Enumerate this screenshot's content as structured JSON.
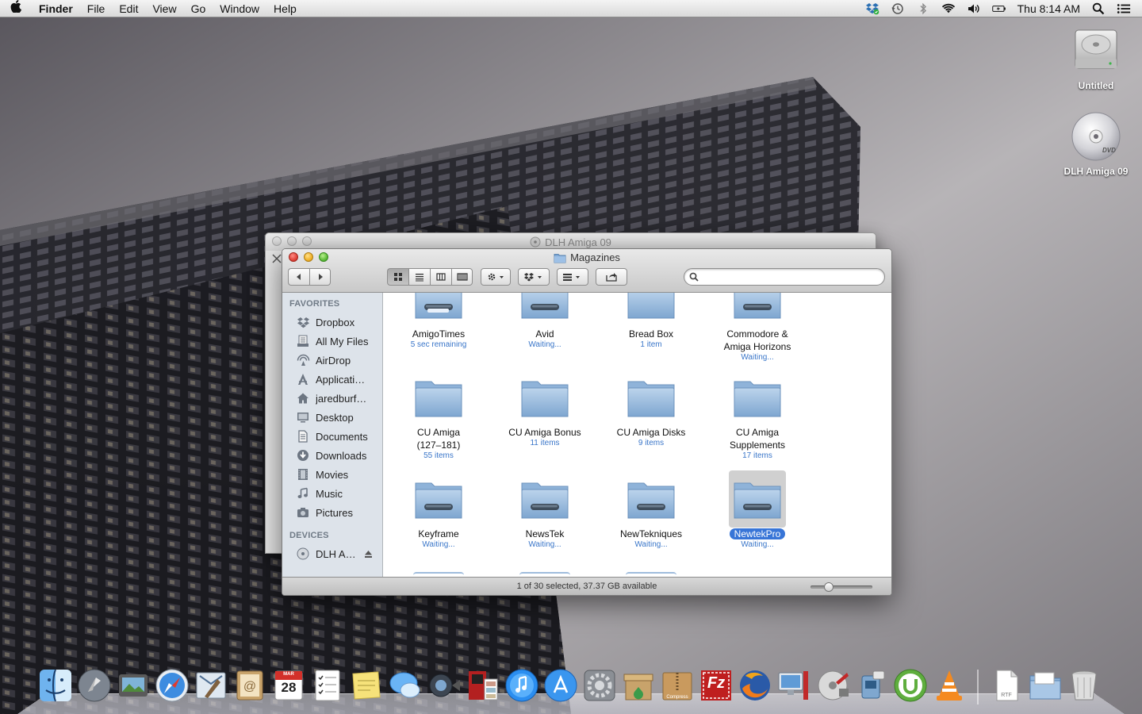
{
  "menubar": {
    "app_name": "Finder",
    "menus": [
      "File",
      "Edit",
      "View",
      "Go",
      "Window",
      "Help"
    ],
    "clock": "Thu 8:14 AM"
  },
  "desktop": {
    "icons": [
      {
        "label": "Untitled",
        "icon": "hard-drive-icon"
      },
      {
        "label": "DLH Amiga 09",
        "icon": "dvd-icon"
      }
    ]
  },
  "back_window": {
    "title": "DLH Amiga 09"
  },
  "window": {
    "title": "Magazines",
    "search": {
      "value": "",
      "placeholder": ""
    },
    "sidebar": {
      "favorites_heading": "FAVORITES",
      "favorites": [
        {
          "label": "Dropbox",
          "icon": "dropbox-icon"
        },
        {
          "label": "All My Files",
          "icon": "all-files-icon"
        },
        {
          "label": "AirDrop",
          "icon": "airdrop-icon"
        },
        {
          "label": "Applicati…",
          "icon": "applications-icon"
        },
        {
          "label": "jaredburf…",
          "icon": "home-icon"
        },
        {
          "label": "Desktop",
          "icon": "desktop-icon"
        },
        {
          "label": "Documents",
          "icon": "documents-icon"
        },
        {
          "label": "Downloads",
          "icon": "downloads-icon"
        },
        {
          "label": "Movies",
          "icon": "movies-icon"
        },
        {
          "label": "Music",
          "icon": "music-icon"
        },
        {
          "label": "Pictures",
          "icon": "pictures-icon"
        }
      ],
      "devices_heading": "DEVICES",
      "devices": [
        {
          "label": "DLH A…",
          "icon": "disc-icon"
        }
      ]
    },
    "items": [
      {
        "name": "AmigoTimes",
        "sub": "5 sec remaining",
        "progress": 0.9,
        "selected": false
      },
      {
        "name": "Avid",
        "sub": "Waiting...",
        "progress": 0,
        "selected": false
      },
      {
        "name": "Bread Box",
        "sub": "1 item",
        "progress": null,
        "selected": false
      },
      {
        "name": "Commodore & Amiga Horizons",
        "sub": "Waiting...",
        "progress": 0,
        "selected": false
      },
      {
        "name": "CU Amiga (127–181)",
        "sub": "55 items",
        "progress": null,
        "selected": false
      },
      {
        "name": "CU Amiga Bonus",
        "sub": "11 items",
        "progress": null,
        "selected": false
      },
      {
        "name": "CU Amiga Disks",
        "sub": "9 items",
        "progress": null,
        "selected": false
      },
      {
        "name": "CU Amiga Supplements",
        "sub": "17 items",
        "progress": null,
        "selected": false
      },
      {
        "name": "Keyframe",
        "sub": "Waiting...",
        "progress": 0,
        "selected": false
      },
      {
        "name": "NewsTek",
        "sub": "Waiting...",
        "progress": 0,
        "selected": false
      },
      {
        "name": "NewTekniques",
        "sub": "Waiting...",
        "progress": 0,
        "selected": false
      },
      {
        "name": "NewtekPro",
        "sub": "Waiting...",
        "progress": 0,
        "selected": true
      }
    ],
    "status_text": "1 of 30 selected, 37.37 GB available",
    "icon_size_fraction": 0.25
  },
  "dock": {
    "apps": [
      "finder-icon",
      "launchpad-icon",
      "image-capture-icon",
      "safari-icon",
      "mail-icon",
      "address-book-icon",
      "ical-icon",
      "reminders-icon",
      "stickies-icon",
      "messages-icon",
      "facetime-icon",
      "photo-booth-icon",
      "itunes-icon",
      "app-store-icon",
      "system-preferences-icon",
      "archive-utility-icon",
      "compress-icon",
      "filezilla-icon",
      "firefox-icon",
      "migration-icon",
      "disk-utility-icon",
      "automator-icon",
      "utorrent-icon",
      "vlc-icon"
    ],
    "stack": [
      "documents-stack-icon",
      "downloads-stack-icon",
      "trash-icon"
    ],
    "ical_month": "MAR",
    "ical_day": "28",
    "compress_label": "Compress",
    "filezilla_letter": "Fz",
    "doc_label": "RTF"
  }
}
